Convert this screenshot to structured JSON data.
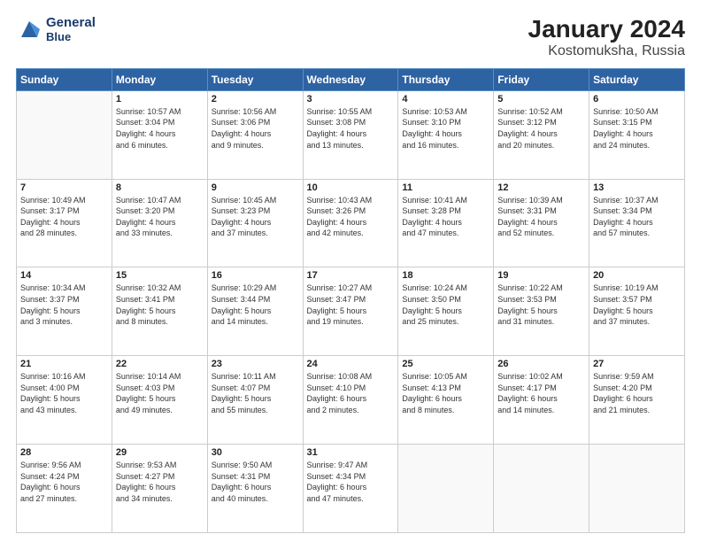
{
  "header": {
    "logo_general": "General",
    "logo_blue": "Blue",
    "title": "January 2024",
    "subtitle": "Kostomuksha, Russia"
  },
  "calendar": {
    "days_of_week": [
      "Sunday",
      "Monday",
      "Tuesday",
      "Wednesday",
      "Thursday",
      "Friday",
      "Saturday"
    ],
    "weeks": [
      [
        {
          "day": "",
          "info": "",
          "empty": true
        },
        {
          "day": "1",
          "info": "Sunrise: 10:57 AM\nSunset: 3:04 PM\nDaylight: 4 hours\nand 6 minutes."
        },
        {
          "day": "2",
          "info": "Sunrise: 10:56 AM\nSunset: 3:06 PM\nDaylight: 4 hours\nand 9 minutes."
        },
        {
          "day": "3",
          "info": "Sunrise: 10:55 AM\nSunset: 3:08 PM\nDaylight: 4 hours\nand 13 minutes."
        },
        {
          "day": "4",
          "info": "Sunrise: 10:53 AM\nSunset: 3:10 PM\nDaylight: 4 hours\nand 16 minutes."
        },
        {
          "day": "5",
          "info": "Sunrise: 10:52 AM\nSunset: 3:12 PM\nDaylight: 4 hours\nand 20 minutes."
        },
        {
          "day": "6",
          "info": "Sunrise: 10:50 AM\nSunset: 3:15 PM\nDaylight: 4 hours\nand 24 minutes."
        }
      ],
      [
        {
          "day": "7",
          "info": "Sunrise: 10:49 AM\nSunset: 3:17 PM\nDaylight: 4 hours\nand 28 minutes."
        },
        {
          "day": "8",
          "info": "Sunrise: 10:47 AM\nSunset: 3:20 PM\nDaylight: 4 hours\nand 33 minutes."
        },
        {
          "day": "9",
          "info": "Sunrise: 10:45 AM\nSunset: 3:23 PM\nDaylight: 4 hours\nand 37 minutes."
        },
        {
          "day": "10",
          "info": "Sunrise: 10:43 AM\nSunset: 3:26 PM\nDaylight: 4 hours\nand 42 minutes."
        },
        {
          "day": "11",
          "info": "Sunrise: 10:41 AM\nSunset: 3:28 PM\nDaylight: 4 hours\nand 47 minutes."
        },
        {
          "day": "12",
          "info": "Sunrise: 10:39 AM\nSunset: 3:31 PM\nDaylight: 4 hours\nand 52 minutes."
        },
        {
          "day": "13",
          "info": "Sunrise: 10:37 AM\nSunset: 3:34 PM\nDaylight: 4 hours\nand 57 minutes."
        }
      ],
      [
        {
          "day": "14",
          "info": "Sunrise: 10:34 AM\nSunset: 3:37 PM\nDaylight: 5 hours\nand 3 minutes."
        },
        {
          "day": "15",
          "info": "Sunrise: 10:32 AM\nSunset: 3:41 PM\nDaylight: 5 hours\nand 8 minutes."
        },
        {
          "day": "16",
          "info": "Sunrise: 10:29 AM\nSunset: 3:44 PM\nDaylight: 5 hours\nand 14 minutes."
        },
        {
          "day": "17",
          "info": "Sunrise: 10:27 AM\nSunset: 3:47 PM\nDaylight: 5 hours\nand 19 minutes."
        },
        {
          "day": "18",
          "info": "Sunrise: 10:24 AM\nSunset: 3:50 PM\nDaylight: 5 hours\nand 25 minutes."
        },
        {
          "day": "19",
          "info": "Sunrise: 10:22 AM\nSunset: 3:53 PM\nDaylight: 5 hours\nand 31 minutes."
        },
        {
          "day": "20",
          "info": "Sunrise: 10:19 AM\nSunset: 3:57 PM\nDaylight: 5 hours\nand 37 minutes."
        }
      ],
      [
        {
          "day": "21",
          "info": "Sunrise: 10:16 AM\nSunset: 4:00 PM\nDaylight: 5 hours\nand 43 minutes."
        },
        {
          "day": "22",
          "info": "Sunrise: 10:14 AM\nSunset: 4:03 PM\nDaylight: 5 hours\nand 49 minutes."
        },
        {
          "day": "23",
          "info": "Sunrise: 10:11 AM\nSunset: 4:07 PM\nDaylight: 5 hours\nand 55 minutes."
        },
        {
          "day": "24",
          "info": "Sunrise: 10:08 AM\nSunset: 4:10 PM\nDaylight: 6 hours\nand 2 minutes."
        },
        {
          "day": "25",
          "info": "Sunrise: 10:05 AM\nSunset: 4:13 PM\nDaylight: 6 hours\nand 8 minutes."
        },
        {
          "day": "26",
          "info": "Sunrise: 10:02 AM\nSunset: 4:17 PM\nDaylight: 6 hours\nand 14 minutes."
        },
        {
          "day": "27",
          "info": "Sunrise: 9:59 AM\nSunset: 4:20 PM\nDaylight: 6 hours\nand 21 minutes."
        }
      ],
      [
        {
          "day": "28",
          "info": "Sunrise: 9:56 AM\nSunset: 4:24 PM\nDaylight: 6 hours\nand 27 minutes."
        },
        {
          "day": "29",
          "info": "Sunrise: 9:53 AM\nSunset: 4:27 PM\nDaylight: 6 hours\nand 34 minutes."
        },
        {
          "day": "30",
          "info": "Sunrise: 9:50 AM\nSunset: 4:31 PM\nDaylight: 6 hours\nand 40 minutes."
        },
        {
          "day": "31",
          "info": "Sunrise: 9:47 AM\nSunset: 4:34 PM\nDaylight: 6 hours\nand 47 minutes."
        },
        {
          "day": "",
          "info": "",
          "empty": true
        },
        {
          "day": "",
          "info": "",
          "empty": true
        },
        {
          "day": "",
          "info": "",
          "empty": true
        }
      ]
    ]
  }
}
